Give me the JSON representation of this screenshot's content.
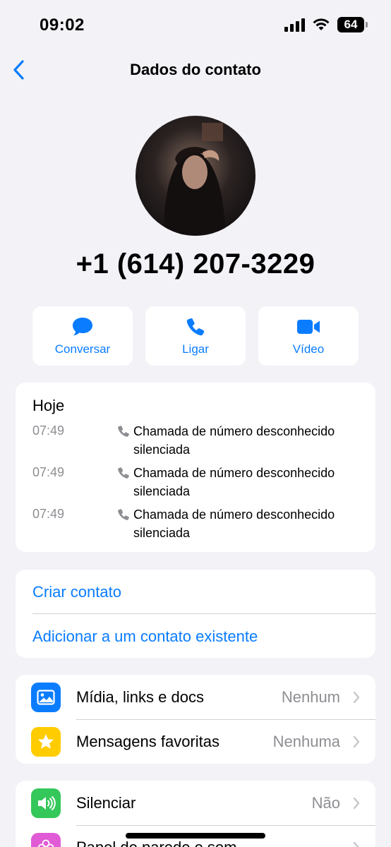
{
  "status_bar": {
    "time": "09:02",
    "battery": "64"
  },
  "nav": {
    "title": "Dados do contato"
  },
  "contact": {
    "phone": "+1 (614) 207-3229"
  },
  "actions": [
    {
      "label": "Conversar",
      "icon": "message-icon"
    },
    {
      "label": "Ligar",
      "icon": "phone-icon"
    },
    {
      "label": "Vídeo",
      "icon": "video-icon"
    }
  ],
  "history": {
    "day": "Hoje",
    "calls": [
      {
        "time": "07:49",
        "line1": "Chamada de número desconhecido",
        "line2": "silenciada"
      },
      {
        "time": "07:49",
        "line1": "Chamada de número desconhecido",
        "line2": "silenciada"
      },
      {
        "time": "07:49",
        "line1": "Chamada de número desconhecido",
        "line2": "silenciada"
      }
    ]
  },
  "contact_actions": {
    "create": "Criar contato",
    "add_existing": "Adicionar a um contato existente"
  },
  "media_section": {
    "items": [
      {
        "label": "Mídia, links e docs",
        "value": "Nenhum",
        "icon": "photo-icon",
        "color": "#0a7cff"
      },
      {
        "label": "Mensagens favoritas",
        "value": "Nenhuma",
        "icon": "star-icon",
        "color": "#ffcc00"
      }
    ]
  },
  "settings_section": {
    "items": [
      {
        "label": "Silenciar",
        "value": "Não",
        "icon": "speaker-icon",
        "color": "#34c759"
      },
      {
        "label": "Papel de parede e som",
        "value": "",
        "icon": "flower-icon",
        "color": "#e05bd5"
      }
    ]
  },
  "colors": {
    "accent": "#0a7cff",
    "background": "#f2f2f7",
    "secondary_text": "#8e8e93"
  }
}
